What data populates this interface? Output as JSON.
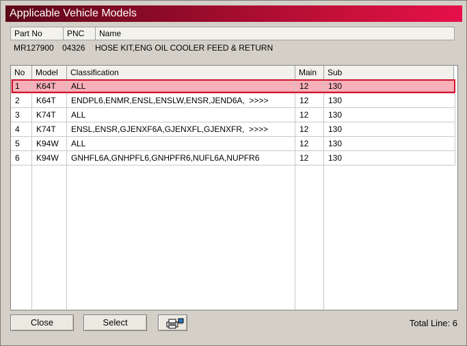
{
  "window": {
    "title": "Applicable Vehicle Models"
  },
  "part_info": {
    "headers": [
      "Part No",
      "PNC",
      "Name"
    ],
    "part_no": "MR127900",
    "pnc": "04326",
    "name": "HOSE KIT,ENG OIL COOLER FEED & RETURN"
  },
  "models_table": {
    "columns": [
      "No",
      "Model",
      "Classification",
      "Main",
      "Sub"
    ],
    "selected_row": 0,
    "rows": [
      {
        "no": "1",
        "model": "K64T",
        "classification": "ALL",
        "main": "12",
        "sub": "130"
      },
      {
        "no": "2",
        "model": "K64T",
        "classification": "ENDPL6,ENMR,ENSL,ENSLW,ENSR,JEND6A,  >>>>",
        "main": "12",
        "sub": "130"
      },
      {
        "no": "3",
        "model": "K74T",
        "classification": "ALL",
        "main": "12",
        "sub": "130"
      },
      {
        "no": "4",
        "model": "K74T",
        "classification": "ENSL,ENSR,GJENXF6A,GJENXFL,GJENXFR,  >>>>",
        "main": "12",
        "sub": "130"
      },
      {
        "no": "5",
        "model": "K94W",
        "classification": "ALL",
        "main": "12",
        "sub": "130"
      },
      {
        "no": "6",
        "model": "K94W",
        "classification": "GNHFL6A,GNHPFL6,GNHPFR6,NUFL6A,NUPFR6",
        "main": "12",
        "sub": "130"
      }
    ]
  },
  "footer": {
    "close_label": "Close",
    "select_label": "Select",
    "print_icon": "printer-icon",
    "total_label": "Total Line:",
    "total_value": "6"
  },
  "colors": {
    "title_gradient_start": "#5c0818",
    "title_gradient_end": "#e6104a",
    "selected_row_fill": "#f7b0b8",
    "selected_row_border": "#d0102e"
  }
}
